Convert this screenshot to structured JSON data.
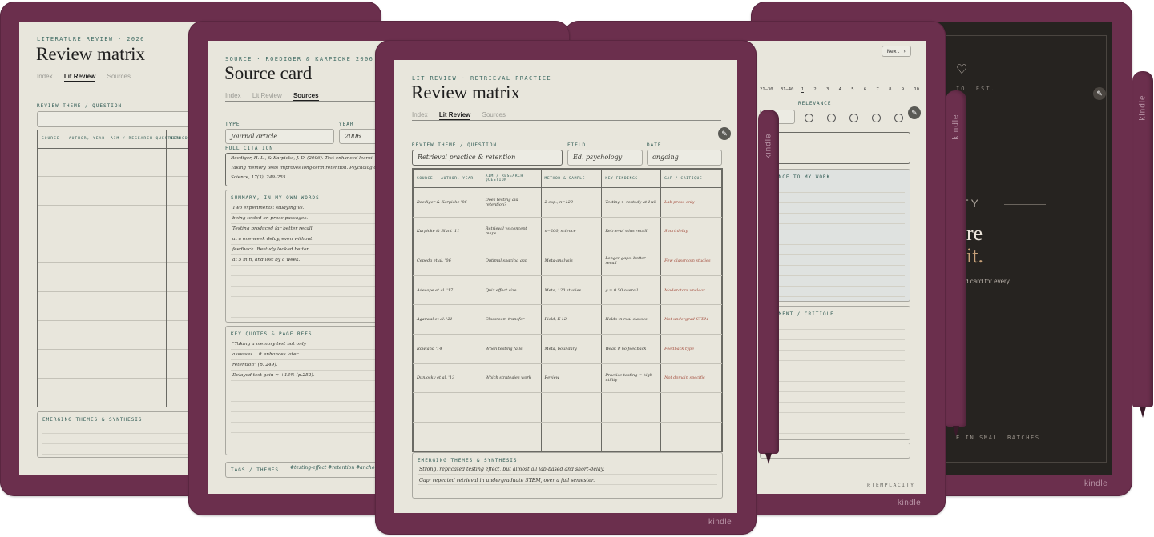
{
  "brand_label": "kindle",
  "far_left": {
    "eyebrow": "LITERATURE REVIEW · 2026",
    "title": "Review matrix",
    "tabs": [
      "Index",
      "Lit Review",
      "Sources"
    ],
    "active_tab": "Lit Review",
    "theme_label": "REVIEW THEME / QUESTION",
    "columns": [
      "SOURCE — AUTHOR, YEAR",
      "AIM / RESEARCH QUESTION",
      "METHOD"
    ],
    "synthesis_label": "EMERGING THEMES & SYNTHESIS"
  },
  "source_card": {
    "eyebrow": "SOURCE · ROEDIGER & KARPICKE 2006",
    "title": "Source card",
    "tabs": [
      "Index",
      "Lit Review",
      "Sources"
    ],
    "active_tab": "Sources",
    "type_label": "TYPE",
    "type_value": "Journal article",
    "year_label": "YEAR",
    "year_value": "2006",
    "citation_label": "FULL CITATION",
    "citation_lines": [
      "Roediger, H. L., & Karpicke, J. D. (2006). Test-enhanced learni",
      "Taking memory tests improves long-term retention. Psychologica",
      "Science, 17(3), 249–255."
    ],
    "summary_label": "SUMMARY, IN MY OWN WORDS",
    "summary_lines": [
      "Two experiments: studying vs.",
      "being tested on prose passages.",
      "Testing produced far better recall",
      "at a one-week delay, even without",
      "feedback. Restudy looked better",
      "at 5 min, and lost by a week."
    ],
    "quotes_label": "KEY QUOTES & PAGE REFS",
    "quotes_lines": [
      "\"Taking a memory test not only",
      "assesses… it enhances later",
      "retention\" (p. 249).",
      "Delayed-test gain ≈ +13% (p.252)."
    ],
    "tags_label": "TAGS / THEMES",
    "tags_value": "#testing-effect  #retention  #ancho"
  },
  "center": {
    "eyebrow": "LIT REVIEW · RETRIEVAL PRACTICE",
    "title": "Review matrix",
    "tabs": [
      "Index",
      "Lit Review",
      "Sources"
    ],
    "active_tab": "Lit Review",
    "theme_label": "REVIEW THEME / QUESTION",
    "theme_value": "Retrieval practice & retention",
    "field_label": "FIELD",
    "field_value": "Ed. psychology",
    "date_label": "DATE",
    "date_value": "ongoing",
    "columns": [
      "SOURCE — AUTHOR, YEAR",
      "AIM / RESEARCH QUESTION",
      "METHOD & SAMPLE",
      "KEY FINDINGS",
      "GAP / CRITIQUE"
    ],
    "rows": [
      [
        "Roediger & Karpicke '06",
        "Does testing aid retention?",
        "2 exp., n=120",
        "Testing > restudy at 1wk",
        "Lab prose only"
      ],
      [
        "Karpicke & Blunt '11",
        "Retrieval vs concept maps",
        "n=200, science",
        "Retrieval wins recall",
        "Short delay"
      ],
      [
        "Cepeda et al. '06",
        "Optimal spacing gap",
        "Meta-analysis",
        "Longer gaps, better recall",
        "Few classroom studies"
      ],
      [
        "Adesope et al. '17",
        "Quiz effect size",
        "Meta, 120 studies",
        "g = 0.50 overall",
        "Moderators unclear"
      ],
      [
        "Agarwal et al. '21",
        "Classroom transfer",
        "Field, K-12",
        "Holds in real classes",
        "Not undergrad STEM"
      ],
      [
        "Rowland '14",
        "When testing fails",
        "Meta, boundary",
        "Weak if no feedback",
        "Feedback type"
      ],
      [
        "Dunlosky et al. '13",
        "Which strategies work",
        "Review",
        "Practice testing = high utility",
        "Not domain specific"
      ],
      [
        "",
        "",
        "",
        "",
        ""
      ],
      [
        "",
        "",
        "",
        "",
        ""
      ]
    ],
    "synthesis_label": "EMERGING THEMES & SYNTHESIS",
    "synthesis_lines": [
      "Strong, replicated testing effect, but almost all lab-based and short-delay.",
      "Gap: repeated retrieval in undergraduate STEM, over a full semester."
    ]
  },
  "right_card": {
    "next_button": "Next ›",
    "page_numbers": [
      "21–30",
      "31–40",
      "1",
      "2",
      "3",
      "4",
      "5",
      "6",
      "7",
      "8",
      "9",
      "10"
    ],
    "relevance_label": "RELEVANCE",
    "relevance_partial_label": "ANCE TO MY WORK",
    "assessment_partial_label": "SMENT / CRITIQUE",
    "watermark": "@TEMPLACITY"
  },
  "dark_card": {
    "eyebrow": "IO. EST.",
    "brand_partial": "ITY",
    "headline_line1": "ure",
    "headline_line2": "kit.",
    "subtitle": "ated card for every",
    "footer": "E IN SMALL BATCHES"
  },
  "colors": {
    "device": "#6b2f4d",
    "screen": "#e8e6dc",
    "accent": "#3d6a62",
    "critique": "#a24a3a",
    "dark_screen": "#262320",
    "dark_accent": "#c9a27a"
  },
  "icons": {
    "pen_button": "pen-nib-icon",
    "relevance": "circle-outline-icon"
  }
}
